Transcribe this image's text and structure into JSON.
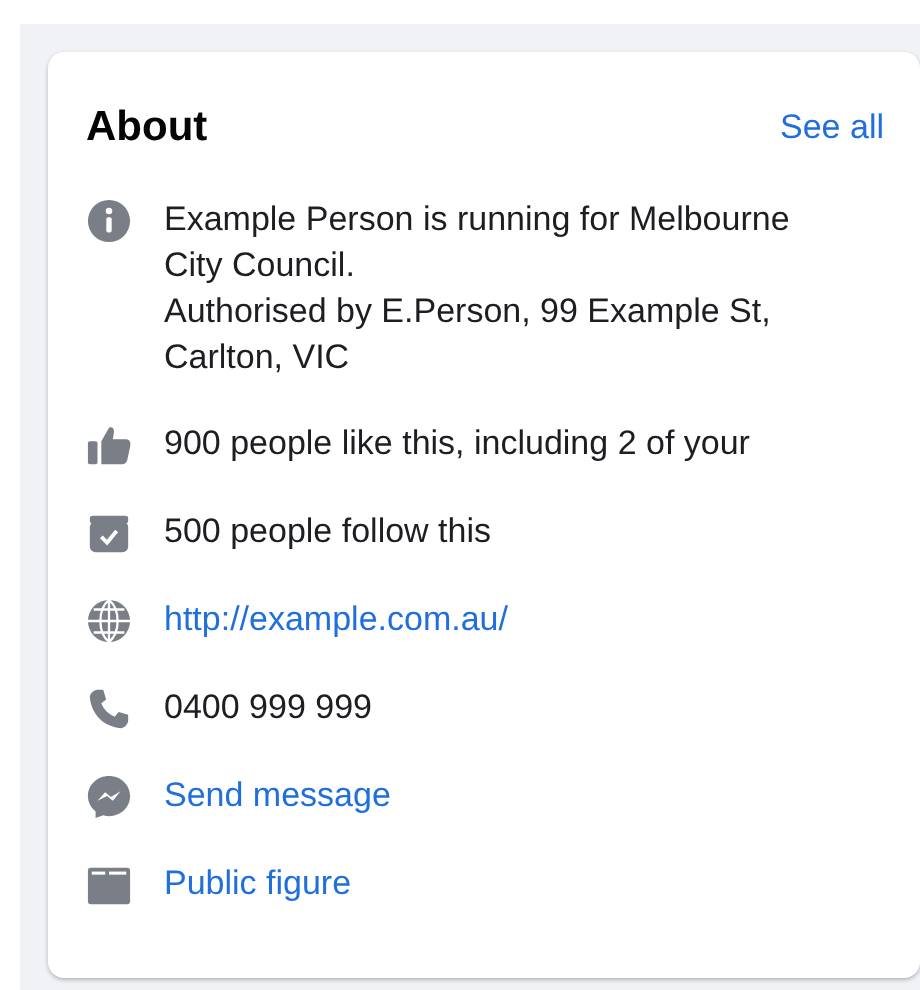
{
  "card": {
    "title": "About",
    "see_all": "See all"
  },
  "items": [
    {
      "kind": "text",
      "lines": [
        "Example Person is running for Melbourne City Council.",
        "Authorised by E.Person, 99 Example St, Carlton, VIC"
      ]
    },
    {
      "kind": "text",
      "lines": [
        "900 people like this, including 2 of your"
      ]
    },
    {
      "kind": "text",
      "lines": [
        "500 people follow this"
      ]
    },
    {
      "kind": "link",
      "lines": [
        "http://example.com.au/"
      ]
    },
    {
      "kind": "text",
      "lines": [
        "0400 999 999"
      ]
    },
    {
      "kind": "link",
      "lines": [
        "Send message"
      ]
    },
    {
      "kind": "link",
      "lines": [
        "Public figure"
      ]
    }
  ]
}
